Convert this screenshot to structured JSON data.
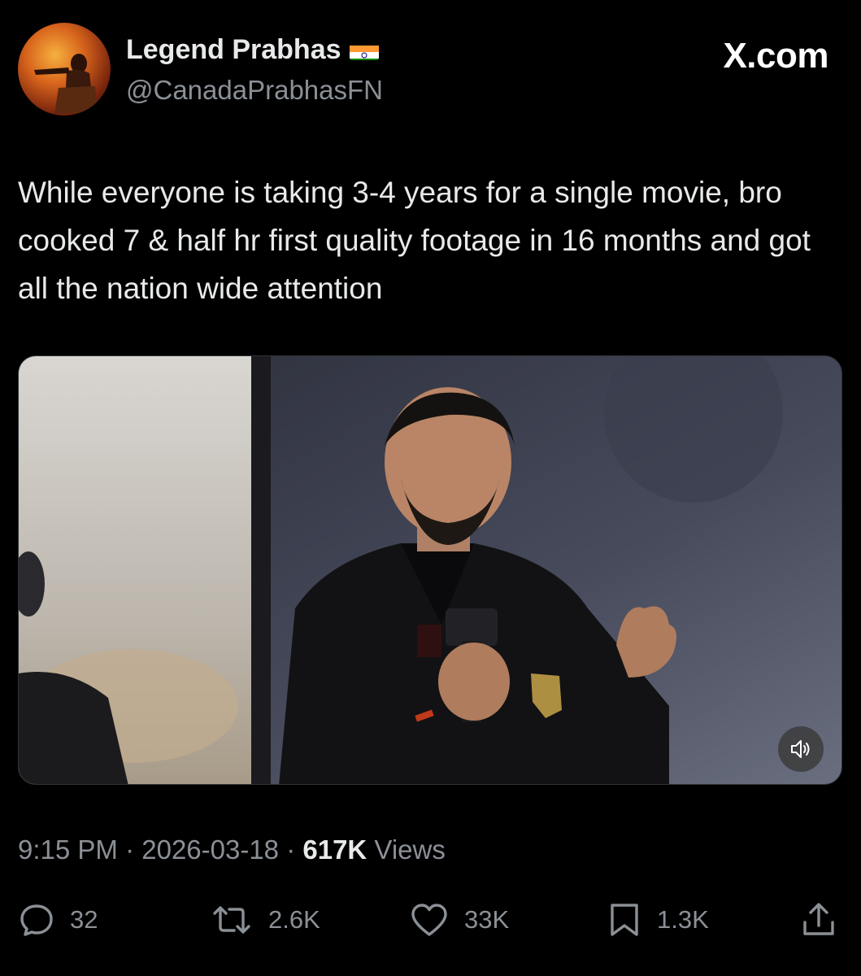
{
  "author": {
    "display_name": "Legend Prabhas",
    "flag_icon": "india-flag-icon",
    "handle": "@CanadaPrabhasFN"
  },
  "brand": "X.com",
  "tweet": {
    "text": "While everyone is taking 3-4 years for a single movie, bro cooked 7 & half hr first quality footage in 16 months and got all the nation wide attention"
  },
  "media": {
    "type": "video",
    "mute_icon": "speaker-mute-icon"
  },
  "meta": {
    "time": "9:15 PM",
    "sep1": " · ",
    "date": "2026-03-18",
    "sep2": " · ",
    "views_count": "617K",
    "views_label": " Views"
  },
  "actions": {
    "replies": "32",
    "reposts": "2.6K",
    "likes": "33K",
    "bookmarks": "1.3K"
  },
  "colors": {
    "background": "#000000",
    "text": "#e7e9ea",
    "secondary": "#8b9096"
  }
}
